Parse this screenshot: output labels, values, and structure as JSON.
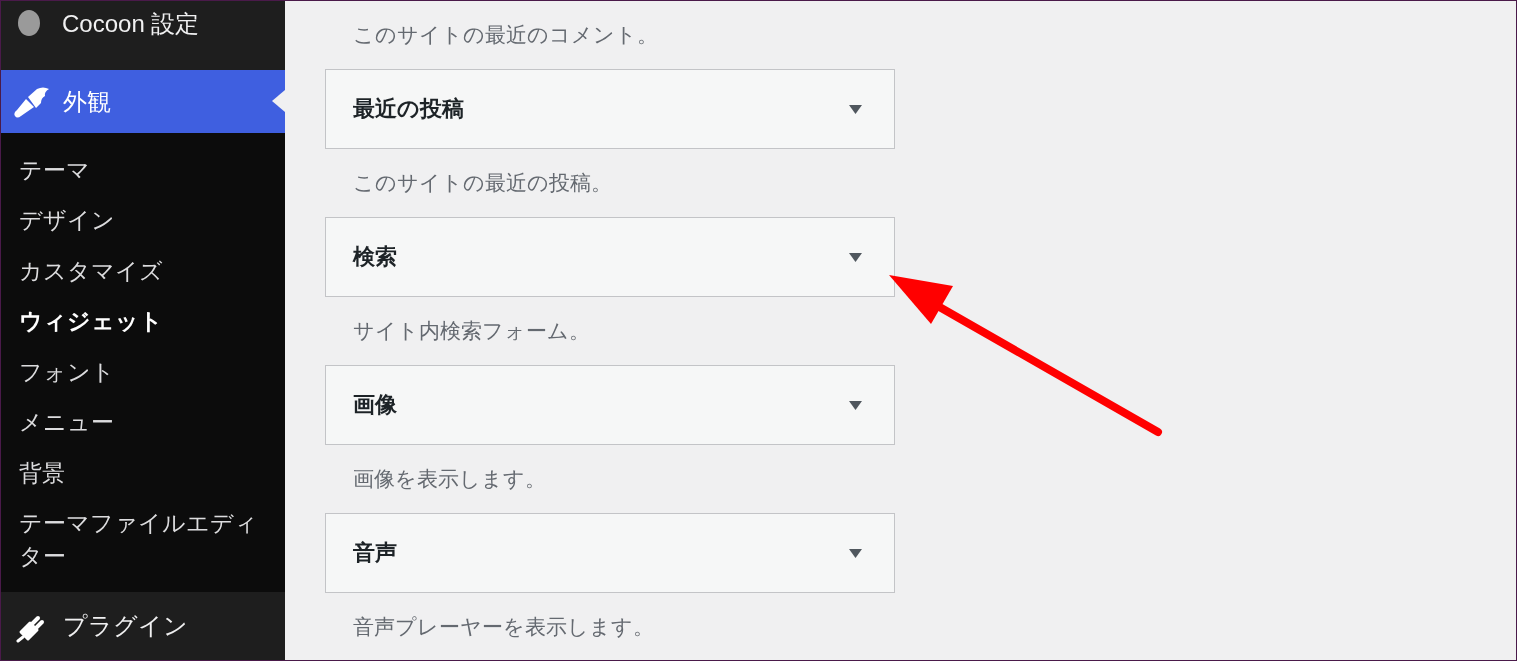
{
  "sidebar": {
    "menu": [
      {
        "label": "Cocoon 設定",
        "selected": false
      },
      {
        "label": "外観",
        "selected": true,
        "submenu": [
          {
            "label": "テーマ",
            "selected": false
          },
          {
            "label": "デザイン",
            "selected": false
          },
          {
            "label": "カスタマイズ",
            "selected": false
          },
          {
            "label": "ウィジェット",
            "selected": true
          },
          {
            "label": "フォント",
            "selected": false
          },
          {
            "label": "メニュー",
            "selected": false
          },
          {
            "label": "背景",
            "selected": false
          },
          {
            "label": "テーマファイルエディター",
            "selected": false
          }
        ]
      },
      {
        "label": "プラグイン",
        "selected": false
      }
    ]
  },
  "widgets": [
    {
      "description": "このサイトの最近のコメント。"
    },
    {
      "title": "最近の投稿",
      "expanded": false,
      "description": "このサイトの最近の投稿。"
    },
    {
      "title": "検索",
      "expanded": false,
      "description": "サイト内検索フォーム。"
    },
    {
      "title": "画像",
      "expanded": false,
      "description": "画像を表示します。"
    },
    {
      "title": "音声",
      "expanded": false,
      "description": "音声プレーヤーを表示します。"
    }
  ]
}
